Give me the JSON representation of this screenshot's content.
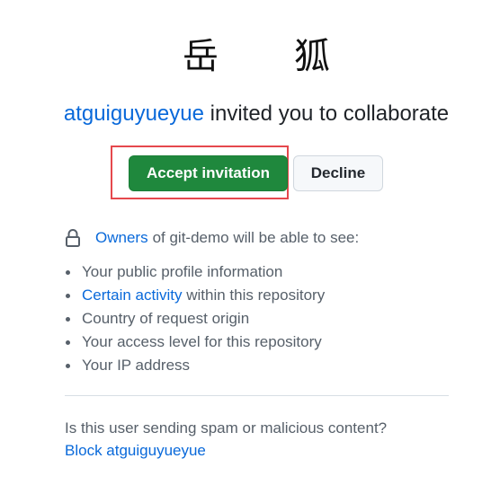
{
  "header": {
    "glyph_left": "岳",
    "glyph_right": "狐"
  },
  "invite": {
    "username": "atguiguyueyue",
    "message": " invited you to collaborate"
  },
  "actions": {
    "accept_label": "Accept invitation",
    "decline_label": "Decline",
    "accept_color": "#1f883d",
    "highlight_color": "#e5484d"
  },
  "visibility": {
    "icon": "lock-icon",
    "owners_link": "Owners",
    "owners_suffix": "of git-demo will be able to see:",
    "items": [
      {
        "link": "",
        "text": "Your public profile information"
      },
      {
        "link": "Certain activity",
        "text": " within this repository"
      },
      {
        "link": "",
        "text": "Country of request origin"
      },
      {
        "link": "",
        "text": "Your access level for this repository"
      },
      {
        "link": "",
        "text": "Your IP address"
      }
    ]
  },
  "report": {
    "question": "Is this user sending spam or malicious content?",
    "block_link": "Block atguiguyueyue"
  }
}
